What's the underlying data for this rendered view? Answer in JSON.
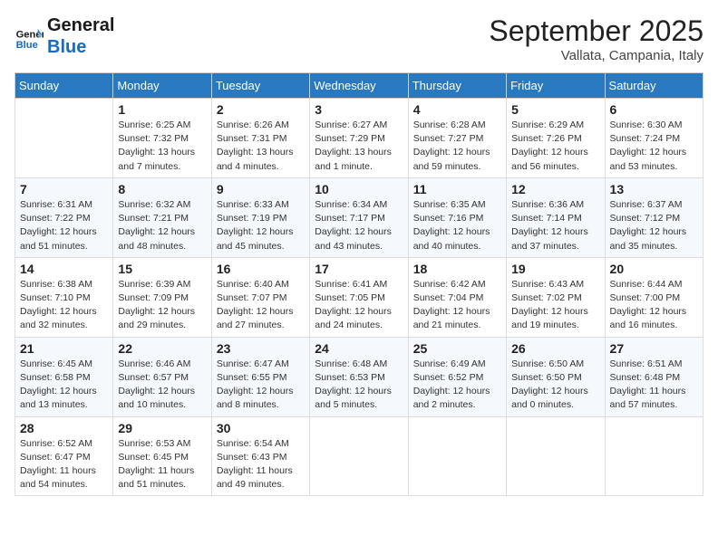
{
  "header": {
    "logo_line1": "General",
    "logo_line2": "Blue",
    "month": "September 2025",
    "location": "Vallata, Campania, Italy"
  },
  "days_of_week": [
    "Sunday",
    "Monday",
    "Tuesday",
    "Wednesday",
    "Thursday",
    "Friday",
    "Saturday"
  ],
  "weeks": [
    [
      {
        "day": "",
        "info": ""
      },
      {
        "day": "1",
        "info": "Sunrise: 6:25 AM\nSunset: 7:32 PM\nDaylight: 13 hours\nand 7 minutes."
      },
      {
        "day": "2",
        "info": "Sunrise: 6:26 AM\nSunset: 7:31 PM\nDaylight: 13 hours\nand 4 minutes."
      },
      {
        "day": "3",
        "info": "Sunrise: 6:27 AM\nSunset: 7:29 PM\nDaylight: 13 hours\nand 1 minute."
      },
      {
        "day": "4",
        "info": "Sunrise: 6:28 AM\nSunset: 7:27 PM\nDaylight: 12 hours\nand 59 minutes."
      },
      {
        "day": "5",
        "info": "Sunrise: 6:29 AM\nSunset: 7:26 PM\nDaylight: 12 hours\nand 56 minutes."
      },
      {
        "day": "6",
        "info": "Sunrise: 6:30 AM\nSunset: 7:24 PM\nDaylight: 12 hours\nand 53 minutes."
      }
    ],
    [
      {
        "day": "7",
        "info": "Sunrise: 6:31 AM\nSunset: 7:22 PM\nDaylight: 12 hours\nand 51 minutes."
      },
      {
        "day": "8",
        "info": "Sunrise: 6:32 AM\nSunset: 7:21 PM\nDaylight: 12 hours\nand 48 minutes."
      },
      {
        "day": "9",
        "info": "Sunrise: 6:33 AM\nSunset: 7:19 PM\nDaylight: 12 hours\nand 45 minutes."
      },
      {
        "day": "10",
        "info": "Sunrise: 6:34 AM\nSunset: 7:17 PM\nDaylight: 12 hours\nand 43 minutes."
      },
      {
        "day": "11",
        "info": "Sunrise: 6:35 AM\nSunset: 7:16 PM\nDaylight: 12 hours\nand 40 minutes."
      },
      {
        "day": "12",
        "info": "Sunrise: 6:36 AM\nSunset: 7:14 PM\nDaylight: 12 hours\nand 37 minutes."
      },
      {
        "day": "13",
        "info": "Sunrise: 6:37 AM\nSunset: 7:12 PM\nDaylight: 12 hours\nand 35 minutes."
      }
    ],
    [
      {
        "day": "14",
        "info": "Sunrise: 6:38 AM\nSunset: 7:10 PM\nDaylight: 12 hours\nand 32 minutes."
      },
      {
        "day": "15",
        "info": "Sunrise: 6:39 AM\nSunset: 7:09 PM\nDaylight: 12 hours\nand 29 minutes."
      },
      {
        "day": "16",
        "info": "Sunrise: 6:40 AM\nSunset: 7:07 PM\nDaylight: 12 hours\nand 27 minutes."
      },
      {
        "day": "17",
        "info": "Sunrise: 6:41 AM\nSunset: 7:05 PM\nDaylight: 12 hours\nand 24 minutes."
      },
      {
        "day": "18",
        "info": "Sunrise: 6:42 AM\nSunset: 7:04 PM\nDaylight: 12 hours\nand 21 minutes."
      },
      {
        "day": "19",
        "info": "Sunrise: 6:43 AM\nSunset: 7:02 PM\nDaylight: 12 hours\nand 19 minutes."
      },
      {
        "day": "20",
        "info": "Sunrise: 6:44 AM\nSunset: 7:00 PM\nDaylight: 12 hours\nand 16 minutes."
      }
    ],
    [
      {
        "day": "21",
        "info": "Sunrise: 6:45 AM\nSunset: 6:58 PM\nDaylight: 12 hours\nand 13 minutes."
      },
      {
        "day": "22",
        "info": "Sunrise: 6:46 AM\nSunset: 6:57 PM\nDaylight: 12 hours\nand 10 minutes."
      },
      {
        "day": "23",
        "info": "Sunrise: 6:47 AM\nSunset: 6:55 PM\nDaylight: 12 hours\nand 8 minutes."
      },
      {
        "day": "24",
        "info": "Sunrise: 6:48 AM\nSunset: 6:53 PM\nDaylight: 12 hours\nand 5 minutes."
      },
      {
        "day": "25",
        "info": "Sunrise: 6:49 AM\nSunset: 6:52 PM\nDaylight: 12 hours\nand 2 minutes."
      },
      {
        "day": "26",
        "info": "Sunrise: 6:50 AM\nSunset: 6:50 PM\nDaylight: 12 hours\nand 0 minutes."
      },
      {
        "day": "27",
        "info": "Sunrise: 6:51 AM\nSunset: 6:48 PM\nDaylight: 11 hours\nand 57 minutes."
      }
    ],
    [
      {
        "day": "28",
        "info": "Sunrise: 6:52 AM\nSunset: 6:47 PM\nDaylight: 11 hours\nand 54 minutes."
      },
      {
        "day": "29",
        "info": "Sunrise: 6:53 AM\nSunset: 6:45 PM\nDaylight: 11 hours\nand 51 minutes."
      },
      {
        "day": "30",
        "info": "Sunrise: 6:54 AM\nSunset: 6:43 PM\nDaylight: 11 hours\nand 49 minutes."
      },
      {
        "day": "",
        "info": ""
      },
      {
        "day": "",
        "info": ""
      },
      {
        "day": "",
        "info": ""
      },
      {
        "day": "",
        "info": ""
      }
    ]
  ]
}
